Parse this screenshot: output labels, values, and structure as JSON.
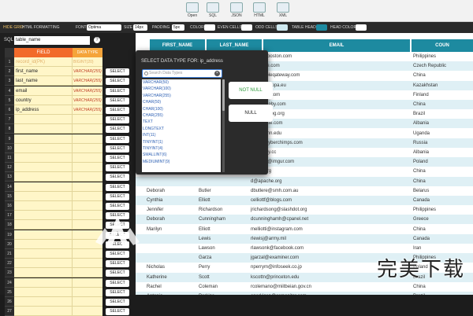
{
  "toolbar": {
    "buttons": [
      {
        "label": "Open",
        "icon": "open-icon"
      },
      {
        "label": "SQL",
        "icon": "sql-icon"
      },
      {
        "label": "JSON",
        "icon": "json-icon"
      },
      {
        "label": "HTML",
        "icon": "html-icon"
      },
      {
        "label": "XML",
        "icon": "xml-icon"
      }
    ]
  },
  "options": {
    "hide_grid": "HIDE GRID",
    "html_formatting": "HTML FORMATTING",
    "font_label": "FONT",
    "font_value": "Optima",
    "size_label": "SIZE",
    "size_value": "14px",
    "padding_label": "PADDING",
    "padding_value": "5px",
    "color_label": "COLOR",
    "even_cells_label": "EVEN CELLS",
    "odd_cells_label": "ODD CELLS",
    "table_head_label": "TABLE HEAD",
    "head_color_label": "HEAD COLOR",
    "accent_color": "#1d8aa0"
  },
  "schema": {
    "sql_label": "SQL",
    "table_name": "table_name",
    "help": "?",
    "field_header": "FIELD",
    "type_header": "DATA TYPE",
    "select_label": "SELECT",
    "rows": [
      {
        "num": "1",
        "field": "record_id(PK)",
        "type": "BIGINT(20)",
        "muted": true
      },
      {
        "num": "2",
        "field": "first_name",
        "type": "VARCHAR(255)"
      },
      {
        "num": "3",
        "field": "last_name",
        "type": "VARCHAR(255)"
      },
      {
        "num": "4",
        "field": "email",
        "type": "VARCHAR(255)"
      },
      {
        "num": "5",
        "field": "country",
        "type": "VARCHAR(255)"
      },
      {
        "num": "6",
        "field": "ip_address",
        "type": "VARCHAR(255)"
      },
      {
        "num": "7",
        "field": "",
        "type": ""
      },
      {
        "num": "8",
        "field": "",
        "type": ""
      },
      {
        "num": "9",
        "field": "",
        "type": ""
      },
      {
        "num": "10",
        "field": "",
        "type": ""
      },
      {
        "num": "11",
        "field": "",
        "type": ""
      },
      {
        "num": "12",
        "field": "",
        "type": ""
      },
      {
        "num": "13",
        "field": "",
        "type": ""
      },
      {
        "num": "14",
        "field": "",
        "type": ""
      },
      {
        "num": "15",
        "field": "",
        "type": ""
      },
      {
        "num": "16",
        "field": "",
        "type": ""
      },
      {
        "num": "17",
        "field": "",
        "type": ""
      },
      {
        "num": "18",
        "field": "",
        "type": ""
      },
      {
        "num": "19",
        "field": "",
        "type": ""
      },
      {
        "num": "20",
        "field": "",
        "type": ""
      },
      {
        "num": "21",
        "field": "",
        "type": ""
      },
      {
        "num": "22",
        "field": "",
        "type": ""
      },
      {
        "num": "23",
        "field": "",
        "type": ""
      },
      {
        "num": "24",
        "field": "",
        "type": ""
      },
      {
        "num": "25",
        "field": "",
        "type": ""
      },
      {
        "num": "26",
        "field": "",
        "type": ""
      },
      {
        "num": "27",
        "field": "",
        "type": ""
      }
    ]
  },
  "popup": {
    "title": "SELECT DATA TYPE FOR: ip_address",
    "search_placeholder": "Search Data Types",
    "types": [
      "VARCHAR(50)",
      "VARCHAR(100)",
      "VARCHAR(255)",
      "CHAR(50)",
      "CHAR(100)",
      "CHAR(255)",
      "TEXT",
      "LONGTEXT",
      "INT(11)",
      "TINYINT(1)",
      "TINYINT(4)",
      "SMALLINT(6)",
      "MEDIUMINT(9)"
    ],
    "not_null": "NOT NULL",
    "null": "NULL"
  },
  "table": {
    "headers": [
      "FIRST_NAME",
      "LAST_NAME",
      "EMAIL",
      "COUN"
    ],
    "rows": [
      [
        "",
        "",
        "ards0@boston.com",
        "Philippines"
      ],
      [
        "",
        "",
        "s1@time.com",
        "Czech Republic"
      ],
      [
        "",
        "",
        "er2@bibleqateway.com",
        "China"
      ],
      [
        "",
        "",
        "cer3@europa.eu",
        "Kazakhstan"
      ],
      [
        "",
        "",
        "n4@com.com",
        "Finland"
      ],
      [
        "",
        "",
        "h5@cdbaby.com",
        "China"
      ],
      [
        "",
        "",
        "son6@prlog.org",
        "Brazil"
      ],
      [
        "",
        "",
        "er7@slate.com",
        "Albania"
      ],
      [
        "",
        "",
        "ch8@umn.edu",
        "Uganda"
      ],
      [
        "",
        "",
        "phy9@cyberchimps.com",
        "Russia"
      ],
      [
        "",
        "",
        "sea@tiny.cc",
        "Albania"
      ],
      [
        "",
        "",
        "mpsonb@imgur.com",
        "Poland"
      ],
      [
        "",
        "",
        "c@un.org",
        "China"
      ],
      [
        "",
        "",
        "d@apache.org",
        "China"
      ],
      [
        "Deborah",
        "Butler",
        "dbutlere@smh.com.au",
        "Belarus"
      ],
      [
        "Cynthia",
        "Elliott",
        "celliottf@blogs.com",
        "Canada"
      ],
      [
        "Jennifer",
        "Richardson",
        "jrichardsong@slashdot.org",
        "Philippines"
      ],
      [
        "Deborah",
        "Cunningham",
        "dcunninghamh@cpanel.net",
        "Greece"
      ],
      [
        "Marilyn",
        "Elliott",
        "melliotti@instagram.com",
        "China"
      ],
      [
        "",
        "Lewis",
        "rlewisj@army.mil",
        "Canada"
      ],
      [
        "",
        "Lawson",
        "rlawsonk@facebook.com",
        "Iran"
      ],
      [
        "",
        "Garza",
        "jgarzal@examiner.com",
        "Philippines"
      ],
      [
        "Nicholas",
        "Perry",
        "nperrym@infoseek.co.jp",
        "Poland"
      ],
      [
        "Katherine",
        "Scott",
        "kscottn@princeton.edu",
        "Brazil"
      ],
      [
        "Rachel",
        "Coleman",
        "rcolemano@miitbeian.gov.cn",
        "China"
      ],
      [
        "Antonio",
        "Perkins",
        "aperkinsp@csmonitor.com",
        "Brazil"
      ],
      [
        "Melissa",
        "Fields",
        "mfieldsq@goodreads.com",
        "Brazil"
      ]
    ]
  },
  "watermark": {
    "text": "完美下载"
  }
}
